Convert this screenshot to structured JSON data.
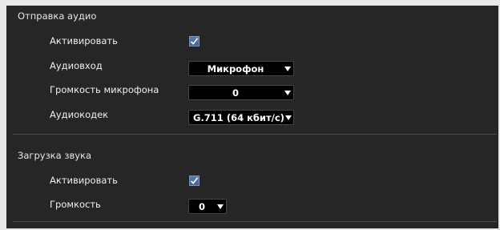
{
  "audio_send": {
    "title": "Отправка аудио",
    "activate_label": "Активировать",
    "activate_checked": true,
    "audio_input_label": "Аудиовход",
    "audio_input_value": "Микрофон",
    "mic_volume_label": "Громкость микрофона",
    "mic_volume_value": "0",
    "codec_label": "Аудиокодек",
    "codec_value": "G.711 (64 кбит/с)"
  },
  "audio_upload": {
    "title": "Загрузка звука",
    "activate_label": "Активировать",
    "activate_checked": true,
    "volume_label": "Громкость",
    "volume_value": "0"
  },
  "icons": {
    "checkmark": "checkmark-icon",
    "dropdown": "dropdown-arrow-icon"
  }
}
